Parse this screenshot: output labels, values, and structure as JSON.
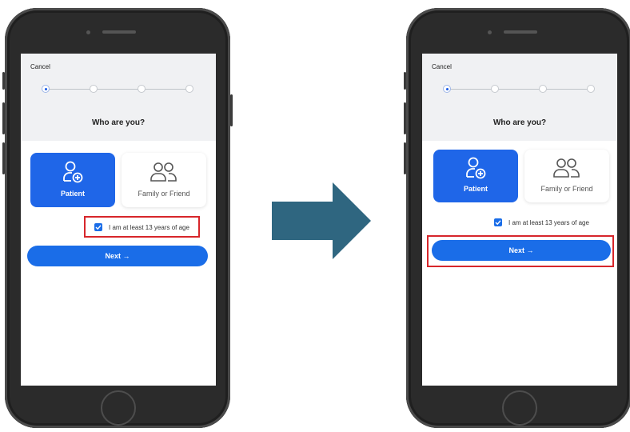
{
  "screens": {
    "left": {
      "cancel_label": "Cancel",
      "title": "Who are you?",
      "options": [
        {
          "label": "Patient",
          "icon": "user-plus-icon",
          "selected": true
        },
        {
          "label": "Family or Friend",
          "icon": "users-icon",
          "selected": false
        }
      ],
      "age_checkbox_label": "I am at least 13 years of age",
      "age_checked": true,
      "next_label": "Next →",
      "highlighted": "age-checkbox"
    },
    "right": {
      "cancel_label": "Cancel",
      "title": "Who are you?",
      "options": [
        {
          "label": "Patient",
          "icon": "user-plus-icon",
          "selected": true
        },
        {
          "label": "Family or Friend",
          "icon": "users-icon",
          "selected": false
        }
      ],
      "age_checkbox_label": "I am at least 13 years of age",
      "age_checked": true,
      "next_label": "Next →",
      "highlighted": "next-button"
    }
  },
  "colors": {
    "primary": "#1f66e8",
    "highlight": "#d7262b",
    "arrow": "#2f6680"
  }
}
